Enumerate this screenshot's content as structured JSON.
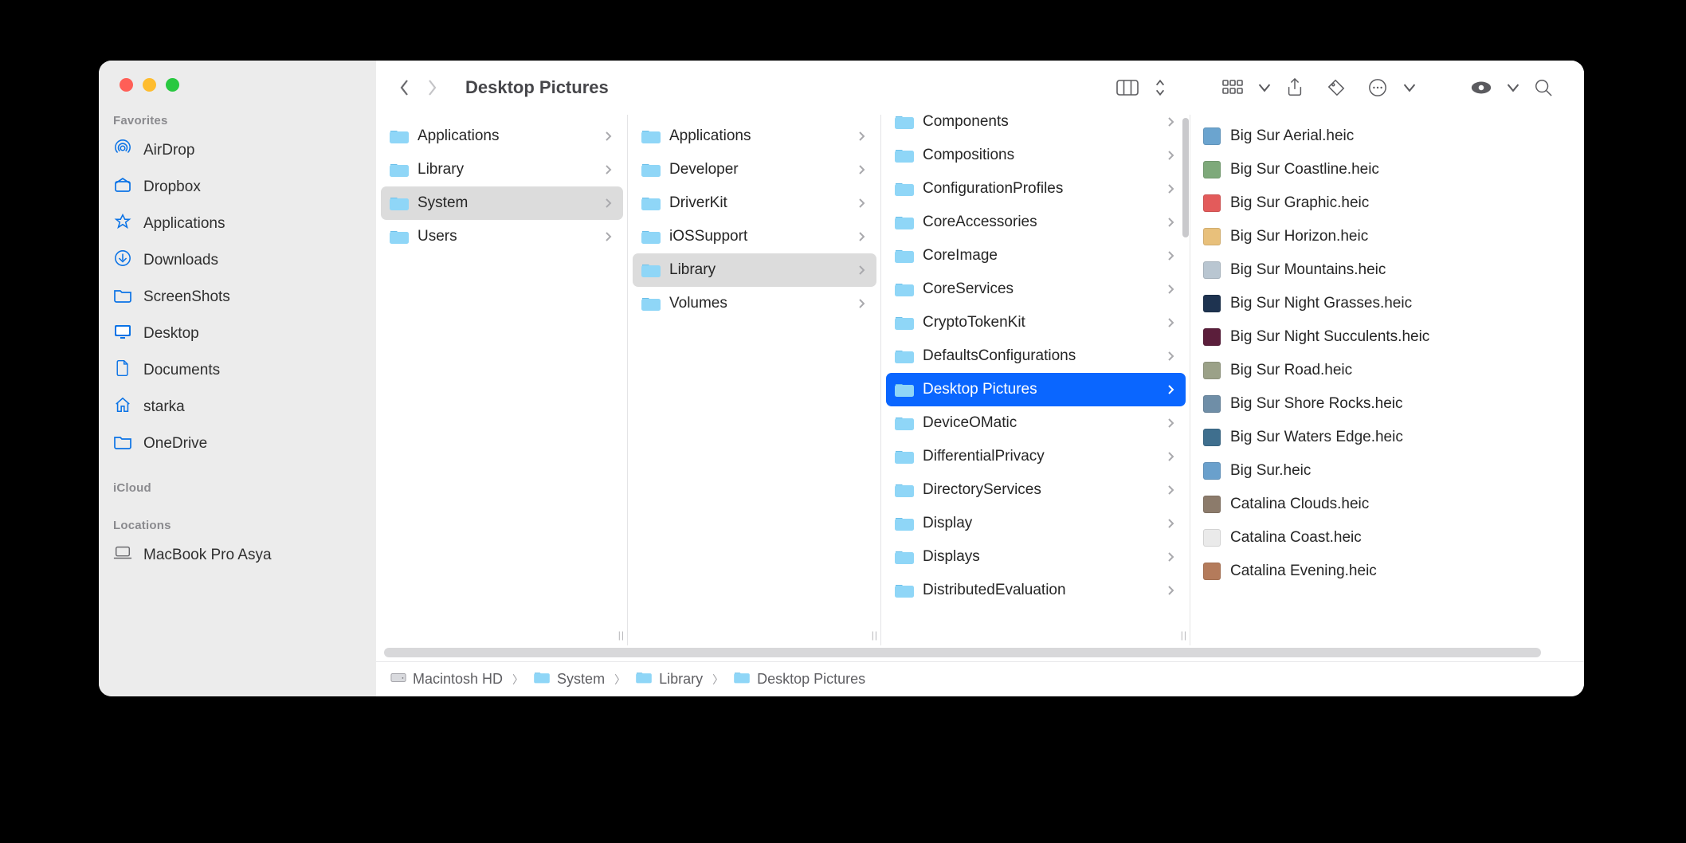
{
  "window_title": "Desktop Pictures",
  "sidebar": {
    "sections": [
      {
        "heading": "Favorites",
        "items": [
          {
            "icon": "airdrop",
            "label": "AirDrop"
          },
          {
            "icon": "dropbox",
            "label": "Dropbox"
          },
          {
            "icon": "appstore",
            "label": "Applications"
          },
          {
            "icon": "download",
            "label": "Downloads"
          },
          {
            "icon": "folder",
            "label": "ScreenShots"
          },
          {
            "icon": "desktop",
            "label": "Desktop"
          },
          {
            "icon": "document",
            "label": "Documents"
          },
          {
            "icon": "home",
            "label": "starka"
          },
          {
            "icon": "folder",
            "label": "OneDrive"
          }
        ]
      },
      {
        "heading": "iCloud",
        "items": []
      },
      {
        "heading": "Locations",
        "items": [
          {
            "icon": "laptop",
            "label": "MacBook Pro Asya"
          }
        ]
      }
    ]
  },
  "columns": [
    {
      "offset": 0,
      "selected_index": 2,
      "items": [
        {
          "label": "Applications",
          "children": true
        },
        {
          "label": "Library",
          "children": true
        },
        {
          "label": "System",
          "children": true
        },
        {
          "label": "Users",
          "children": true
        }
      ]
    },
    {
      "offset": 0,
      "selected_index": 4,
      "items": [
        {
          "label": "Applications",
          "children": true
        },
        {
          "label": "Developer",
          "children": true
        },
        {
          "label": "DriverKit",
          "children": true
        },
        {
          "label": "iOSSupport",
          "children": true
        },
        {
          "label": "Library",
          "children": true
        },
        {
          "label": "Volumes",
          "children": true
        }
      ]
    },
    {
      "offset": -18,
      "selected_index": 8,
      "show_scroll": true,
      "items": [
        {
          "label": "Components",
          "children": true
        },
        {
          "label": "Compositions",
          "children": true
        },
        {
          "label": "ConfigurationProfiles",
          "children": true
        },
        {
          "label": "CoreAccessories",
          "children": true
        },
        {
          "label": "CoreImage",
          "children": true
        },
        {
          "label": "CoreServices",
          "children": true
        },
        {
          "label": "CryptoTokenKit",
          "children": true
        },
        {
          "label": "DefaultsConfigurations",
          "children": true
        },
        {
          "label": "Desktop Pictures",
          "children": true
        },
        {
          "label": "DeviceOMatic",
          "children": true
        },
        {
          "label": "DifferentialPrivacy",
          "children": true
        },
        {
          "label": "DirectoryServices",
          "children": true
        },
        {
          "label": "Display",
          "children": true
        },
        {
          "label": "Displays",
          "children": true
        },
        {
          "label": "DistributedEvaluation",
          "children": true
        }
      ]
    },
    {
      "offset": 0,
      "files": true,
      "items": [
        {
          "label": "Big Sur Aerial.heic",
          "color": "#6BA4CF"
        },
        {
          "label": "Big Sur Coastline.heic",
          "color": "#7EA97A"
        },
        {
          "label": "Big Sur Graphic.heic",
          "color": "#E35B5B"
        },
        {
          "label": "Big Sur Horizon.heic",
          "color": "#E8C07B"
        },
        {
          "label": "Big Sur Mountains.heic",
          "color": "#B9C6D1"
        },
        {
          "label": "Big Sur Night Grasses.heic",
          "color": "#1E3350"
        },
        {
          "label": "Big Sur Night Succulents.heic",
          "color": "#5B1E3B"
        },
        {
          "label": "Big Sur Road.heic",
          "color": "#9BA188"
        },
        {
          "label": "Big Sur Shore Rocks.heic",
          "color": "#6F8EA7"
        },
        {
          "label": "Big Sur Waters Edge.heic",
          "color": "#3F6F8E"
        },
        {
          "label": "Big Sur.heic",
          "color": "#6AA0CC"
        },
        {
          "label": "Catalina Clouds.heic",
          "color": "#8C7B6B"
        },
        {
          "label": "Catalina Coast.heic",
          "color": "#EAEAEA"
        },
        {
          "label": "Catalina Evening.heic",
          "color": "#B47B5B"
        }
      ]
    }
  ],
  "pathbar": [
    {
      "icon": "hd",
      "label": "Macintosh HD"
    },
    {
      "icon": "folder",
      "label": "System"
    },
    {
      "icon": "folder",
      "label": "Library"
    },
    {
      "icon": "folder",
      "label": "Desktop Pictures"
    }
  ]
}
